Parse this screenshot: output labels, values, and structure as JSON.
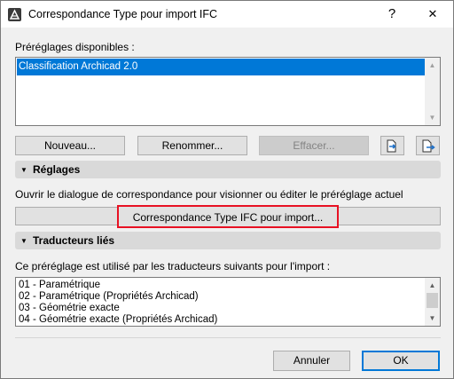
{
  "window": {
    "title": "Correspondance Type pour import IFC",
    "help_icon": "?",
    "close_icon": "✕"
  },
  "presets": {
    "label": "Préréglages disponibles :",
    "items": [
      "Classification Archicad 2.0"
    ],
    "selected_index": 0
  },
  "buttons": {
    "new": "Nouveau...",
    "rename": "Renommer...",
    "delete": "Effacer...",
    "import_icon": "import-file-icon",
    "export_icon": "export-file-icon"
  },
  "settings": {
    "header": "Réglages",
    "description": "Ouvrir le dialogue de correspondance pour visionner ou éditer le préréglage actuel",
    "mapping_button": "Correspondance Type IFC pour import...",
    "highlight_color": "#e81123"
  },
  "translators": {
    "header": "Traducteurs liés",
    "description": "Ce préréglage est utilisé par les traducteurs suivants pour l'import :",
    "items": [
      "01 - Paramétrique",
      "02 - Paramétrique (Propriétés Archicad)",
      "03 - Géométrie exacte",
      "04 - Géométrie exacte (Propriétés Archicad)"
    ]
  },
  "footer": {
    "cancel": "Annuler",
    "ok": "OK"
  },
  "colors": {
    "selection": "#0078d7",
    "accent_border": "#0078d7"
  }
}
